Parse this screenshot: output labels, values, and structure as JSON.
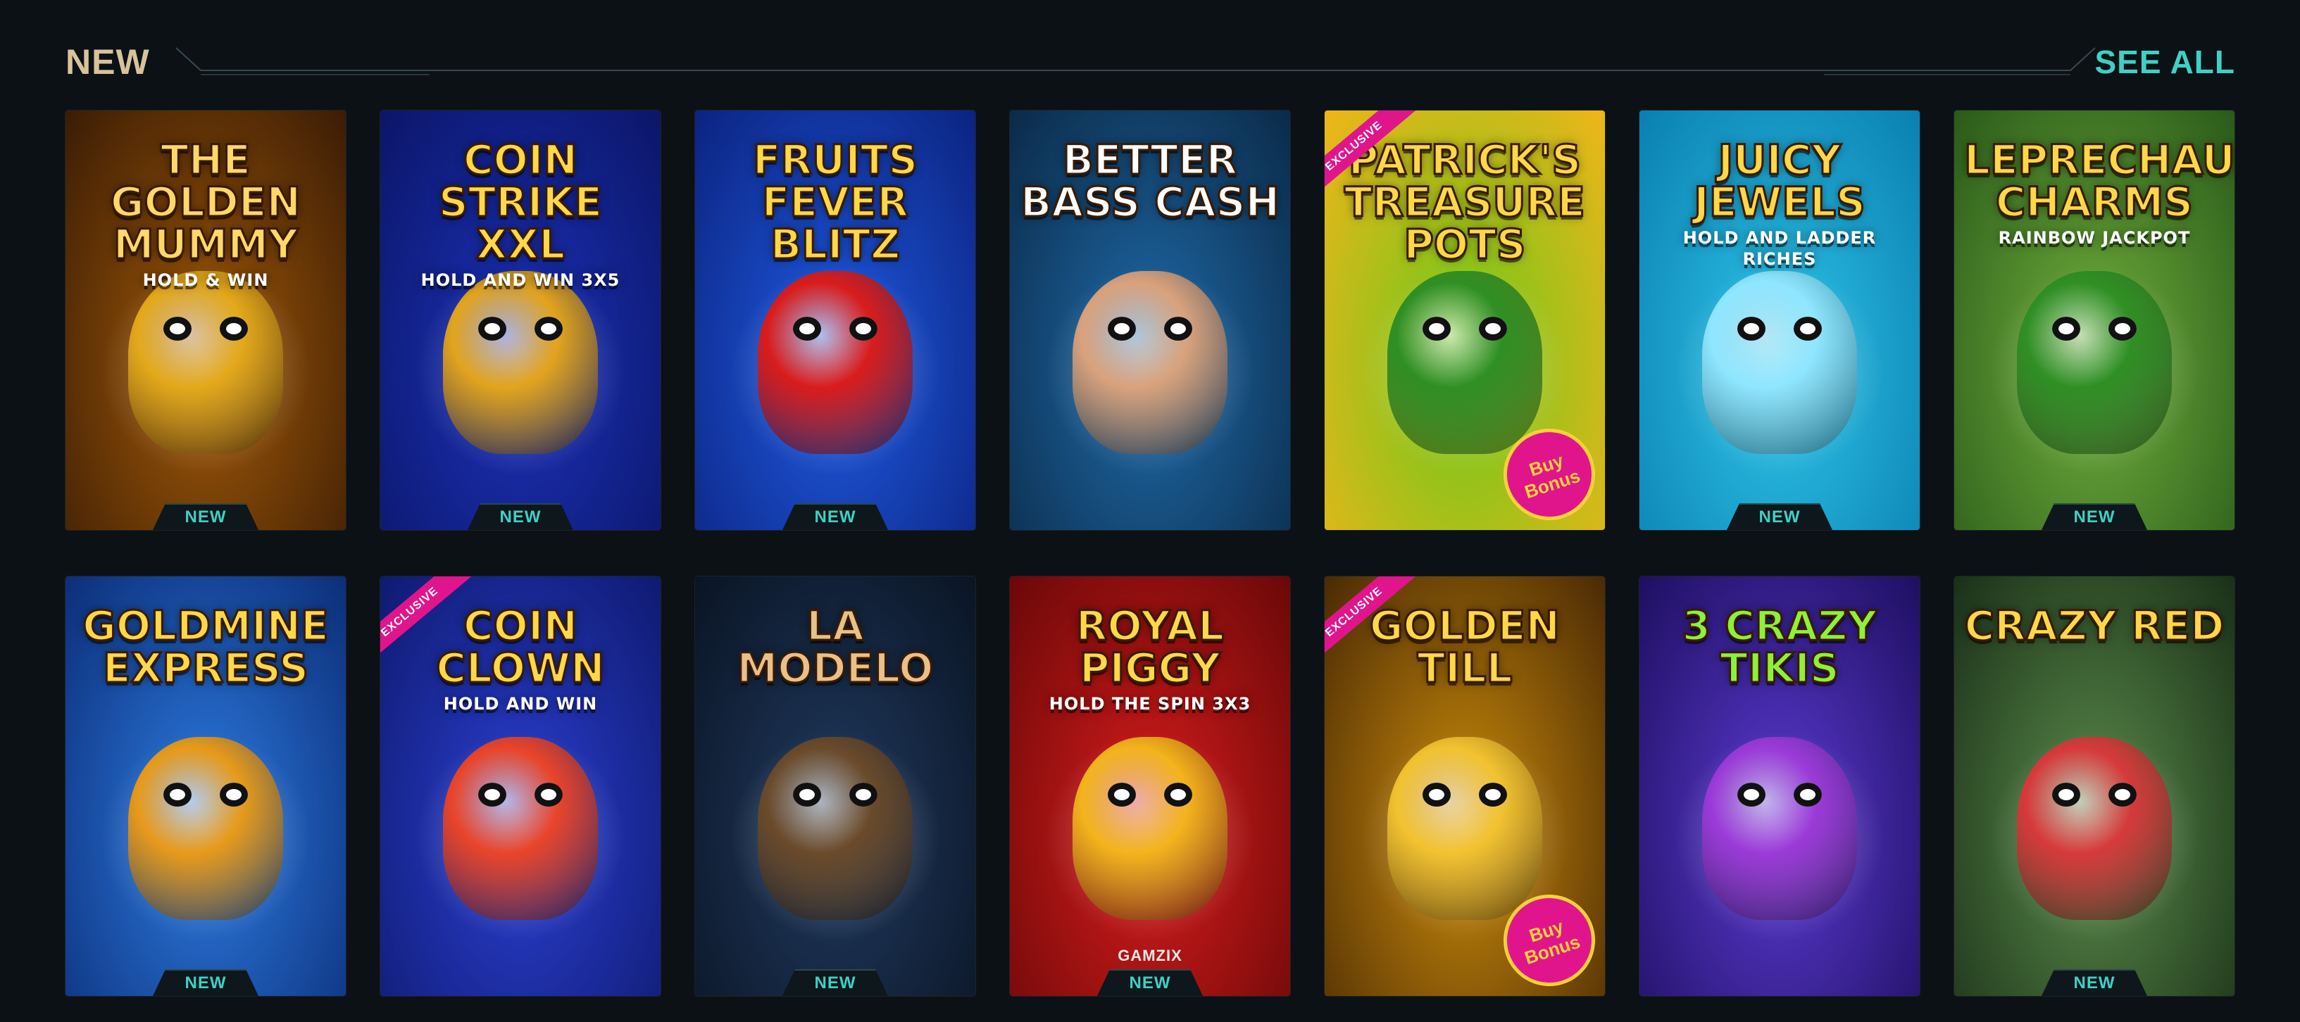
{
  "header": {
    "title": "NEW",
    "see_all": "SEE ALL"
  },
  "games": [
    {
      "id": "golden-mummy",
      "logo": "The Golden Mummy",
      "sub": "Hold & Win",
      "badge": "NEW",
      "bg": "#a35a08",
      "bg2": "#3a1c05",
      "text": "#ffd86a",
      "icon": "mummy-icon",
      "mascot": "#e3a91a"
    },
    {
      "id": "coin-strike-xxl",
      "logo": "Coin Strike XXL",
      "sub": "Hold and Win 3x5",
      "badge": "NEW",
      "bg": "#1c31b8",
      "bg2": "#0b1668",
      "text": "#ffd84a",
      "icon": "lightning-coin-icon",
      "mascot": "#e2a41c"
    },
    {
      "id": "fruits-fever-blitz",
      "logo": "Fruits Fever Blitz",
      "sub": "",
      "badge": "NEW",
      "bg": "#1f5ae0",
      "bg2": "#0b2380",
      "text": "#ffd84a",
      "icon": "seven-icon",
      "mascot": "#d91c1c"
    },
    {
      "id": "better-bass-cash",
      "logo": "Better Bass Cash",
      "sub": "",
      "badge": "",
      "bg": "#1e6aa8",
      "bg2": "#0b2a48",
      "text": "#ffffff",
      "icon": "fisherman-icon",
      "mascot": "#d9a27c"
    },
    {
      "id": "patricks-treasure-pots",
      "logo": "Patrick's Treasure Pots",
      "sub": "",
      "badge": "",
      "bg": "#6bc81a",
      "bg2": "#f0b51a",
      "text": "#ffd84a",
      "icon": "leprechaun-icon",
      "mascot": "#2f8f24",
      "ribbon": "Exclusive",
      "bonus": "Buy Bonus"
    },
    {
      "id": "juicy-jewels",
      "logo": "Juicy Jewels",
      "sub": "Hold and Ladder Riches",
      "badge": "NEW",
      "bg": "#2ec4e8",
      "bg2": "#0a7fb0",
      "text": "#ffd84a",
      "icon": "diamond-icon",
      "mascot": "#8fe6ff"
    },
    {
      "id": "leprechaun-charms",
      "logo": "Leprechaun Charms",
      "sub": "Rainbow Jackpot",
      "badge": "NEW",
      "bg": "#6fae3b",
      "bg2": "#2a5a1a",
      "text": "#ffd84a",
      "icon": "leprechaun-icon",
      "mascot": "#2f8f24"
    },
    {
      "id": "goldmine-express",
      "logo": "Goldmine Express",
      "sub": "",
      "badge": "NEW",
      "bg": "#2c7be0",
      "bg2": "#0c2e78",
      "text": "#ffd84a",
      "icon": "train-icon",
      "mascot": "#e79a1a"
    },
    {
      "id": "coin-clown",
      "logo": "Coin Clown",
      "sub": "Hold and Win",
      "badge": "",
      "bg": "#2a3fd0",
      "bg2": "#0f1a70",
      "text": "#ffd84a",
      "icon": "clown-icon",
      "mascot": "#e9442a",
      "ribbon": "Exclusive"
    },
    {
      "id": "la-modelo",
      "logo": "La Modelo",
      "sub": "",
      "badge": "NEW",
      "bg": "#203a5e",
      "bg2": "#0a1424",
      "text": "#e8c08a",
      "icon": "captain-icon",
      "mascot": "#6a4a2a"
    },
    {
      "id": "royal-piggy",
      "logo": "Royal Piggy",
      "sub": "Hold the Spin 3x3",
      "badge": "NEW",
      "bg": "#d61c1c",
      "bg2": "#6a0808",
      "text": "#ffd84a",
      "icon": "piggy-bank-icon",
      "mascot": "#f3b41c",
      "provider": "GAMZIX"
    },
    {
      "id": "golden-till",
      "logo": "Golden Till",
      "sub": "",
      "badge": "",
      "bg": "#c98a0a",
      "bg2": "#4a2a05",
      "text": "#ffd84a",
      "icon": "cash-register-icon",
      "mascot": "#f2c230",
      "ribbon": "Exclusive",
      "bonus": "Buy Bonus"
    },
    {
      "id": "3-crazy-tikis",
      "logo": "3 Crazy Tikis",
      "sub": "",
      "badge": "",
      "bg": "#5a3ad0",
      "bg2": "#1e0f60",
      "text": "#8ef03a",
      "icon": "tiki-mask-icon",
      "mascot": "#9b3ad8"
    },
    {
      "id": "crazy-red",
      "logo": "Crazy Red",
      "sub": "",
      "badge": "NEW",
      "bg": "#5a8a4a",
      "bg2": "#1a3018",
      "text": "#ffd84a",
      "icon": "parrot-icon",
      "mascot": "#d63a3a"
    }
  ]
}
